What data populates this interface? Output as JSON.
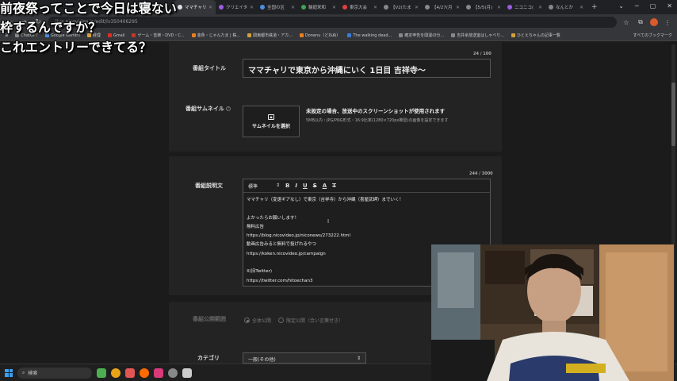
{
  "browser": {
    "tabs": [
      {
        "label": "ママチャリ",
        "color": "#e0e0e0"
      },
      {
        "label": "クリエイタ",
        "color": "#9b5de5"
      },
      {
        "label": "全国の区",
        "color": "#4a90e2"
      },
      {
        "label": "輪廻来和",
        "color": "#3aa657"
      },
      {
        "label": "東京大会",
        "color": "#e04040"
      },
      {
        "label": "【V2(たま",
        "color": "#888888"
      },
      {
        "label": "【4/27(月",
        "color": "#888888"
      },
      {
        "label": "【5/5(月)",
        "color": "#888888"
      },
      {
        "label": "ニコニコ(",
        "color": "#9b5de5"
      },
      {
        "label": "なんとか",
        "color": "#888888"
      }
    ],
    "new_tab": "+",
    "window_controls": [
      "⌄",
      "─",
      "▢",
      "✕"
    ],
    "url": "live.nicovideo.jp/edit/lv350406295",
    "star": "☆",
    "bookmarks": [
      {
        "label": "ChatGPT",
        "color": "#888888"
      },
      {
        "label": "Google Gemini",
        "color": "#4a90e2"
      },
      {
        "label": "経理",
        "color": "#d4a03a"
      },
      {
        "label": "Gmail",
        "color": "#d93025"
      },
      {
        "label": "ゲーム・音楽・DVD・C...",
        "color": "#c0392b"
      },
      {
        "label": "金魚・じゃんたま | 株...",
        "color": "#e67e22"
      },
      {
        "label": "関東都市鉄道・アカ...",
        "color": "#d4a03a"
      },
      {
        "label": "Donenu（どねぬ）",
        "color": "#e67e22"
      },
      {
        "label": "The walking dead...",
        "color": "#3a7bd5"
      },
      {
        "label": "確定申告を間違(0分...",
        "color": "#888888"
      },
      {
        "label": "吉井余放送室はしゃべり...",
        "color": "#888888"
      },
      {
        "label": "ひとえちゃんの記事一覧",
        "color": "#d4a03a"
      }
    ],
    "bookmarks_all": "すべてのブックマーク"
  },
  "overlay": {
    "line1": "前夜祭ってことで今日は寝ない",
    "line2": "枠するんですか？",
    "line3": "これエントリーできてる？"
  },
  "form": {
    "title_counter": "24 / 100",
    "title_label": "番組タイトル",
    "title_value": "ママチャリで東京から沖縄にいく 1日目 吉祥寺〜",
    "thumb_label": "番組サムネイル",
    "thumb_help": "?",
    "thumb_button": "サムネイルを選択",
    "thumb_info": "未設定の場合、放送中のスクリーンショットが使用されます",
    "thumb_sub": "5MB以内・JPG/PNG形式・16:9比率(1280×720px推奨)の画像を設定できます",
    "desc_counter": "244 / 3000",
    "desc_label": "番組説明文",
    "toolbar": {
      "format": "標準",
      "format_arrow": "⇕",
      "bold": "B",
      "italic": "I",
      "underline": "U",
      "strike": "S",
      "color": "A",
      "clear": "T"
    },
    "desc_lines": [
      "ママチャリ（変速ギアなし）で東京（吉祥寺）から沖縄（喜屋武岬）までいく！",
      "",
      "よかったらお願いします！",
      "無料広告",
      "https://blog.nicovideo.jp/niconews/273222.html",
      "動画広告みると無料で投げれるやつ",
      "https://koken.nicovideo.jp/campaign",
      "",
      "X(旧Twitter)",
      "https://twitter.com/hitoechan3"
    ],
    "visibility_label": "番組公開範囲",
    "visibility_options": [
      {
        "label": "全体公開",
        "selected": true
      },
      {
        "label": "限定公開（合い言葉付き）",
        "selected": false
      }
    ],
    "category_label": "カテゴリ",
    "category_value": "一般(その他)",
    "category_arrow": "⇕"
  },
  "taskbar": {
    "search_placeholder": "検索",
    "apps": [
      "#4caf50",
      "#e8a317",
      "#e25555",
      "#ff6b00",
      "#d93a7a",
      "#888888",
      "#cccccc"
    ]
  }
}
